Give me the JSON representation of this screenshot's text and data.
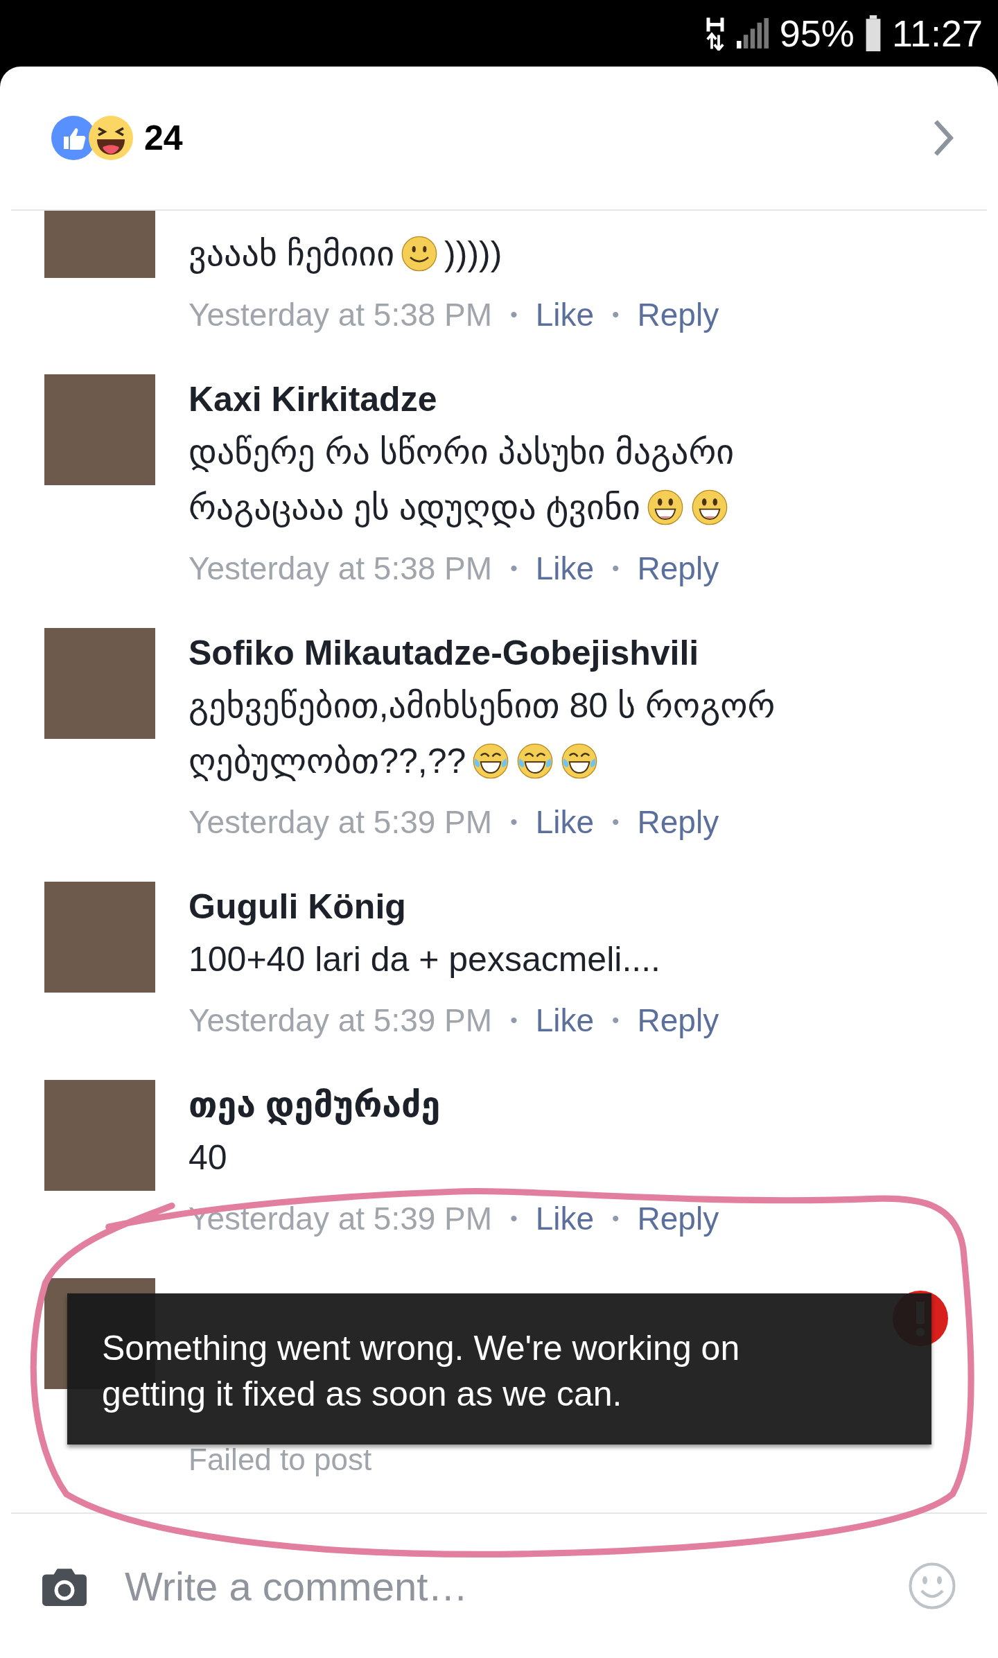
{
  "status_bar": {
    "battery": "95%",
    "time": "11:27"
  },
  "reactions": {
    "count": "24"
  },
  "comments": [
    {
      "kind": "posted",
      "body": [
        {
          "kind": "text",
          "text": "ვააახ ჩემიიი"
        },
        {
          "kind": "smile"
        },
        {
          "kind": "text",
          "text": ")))))"
        }
      ],
      "meta": [
        {
          "kind": "time",
          "text": "Yesterday at 5:38 PM"
        },
        {
          "kind": "dot",
          "text": "•"
        },
        {
          "kind": "like",
          "text": "Like"
        },
        {
          "kind": "dot",
          "text": "•"
        },
        {
          "kind": "reply",
          "text": "Reply"
        }
      ]
    },
    {
      "kind": "posted",
      "author": "Kaxi Kirkitadze",
      "body": [
        {
          "kind": "text",
          "text": "დაწერე რა სწორი პასუხი მაგარი"
        },
        {
          "kind": "text",
          "text": "რაგაცააა ეს ადუღდა ტვინი"
        },
        {
          "kind": "grin"
        },
        {
          "kind": "grin"
        }
      ],
      "meta": [
        {
          "kind": "time",
          "text": "Yesterday at 5:38 PM"
        },
        {
          "kind": "dot",
          "text": "•"
        },
        {
          "kind": "like",
          "text": "Like"
        },
        {
          "kind": "dot",
          "text": "•"
        },
        {
          "kind": "reply",
          "text": "Reply"
        }
      ]
    },
    {
      "kind": "posted",
      "author": "Sofiko Mikautadze-Gobejishvili",
      "body": [
        {
          "kind": "text",
          "text": "გეხვეწებით,ამიხსენით 80 ს როგორ"
        },
        {
          "kind": "text",
          "text": "ღებულობთ??,??"
        },
        {
          "kind": "joy"
        },
        {
          "kind": "joy"
        },
        {
          "kind": "joy"
        }
      ],
      "meta": [
        {
          "kind": "time",
          "text": "Yesterday at 5:39 PM"
        },
        {
          "kind": "dot",
          "text": "•"
        },
        {
          "kind": "like",
          "text": "Like"
        },
        {
          "kind": "dot",
          "text": "•"
        },
        {
          "kind": "reply",
          "text": "Reply"
        }
      ]
    },
    {
      "kind": "posted",
      "author": "Guguli König",
      "body": [
        {
          "kind": "text",
          "text": "100+40 lari da + pexsacmeli...."
        }
      ],
      "meta": [
        {
          "kind": "time",
          "text": "Yesterday at 5:39 PM"
        },
        {
          "kind": "dot",
          "text": "•"
        },
        {
          "kind": "like",
          "text": "Like"
        },
        {
          "kind": "dot",
          "text": "•"
        },
        {
          "kind": "reply",
          "text": "Reply"
        }
      ]
    },
    {
      "kind": "posted",
      "author": "თეა დემურაძე",
      "body": [
        {
          "kind": "text",
          "text": "40"
        }
      ],
      "meta": [
        {
          "kind": "time",
          "text": "Yesterday at 5:39 PM"
        },
        {
          "kind": "dot",
          "text": "•"
        },
        {
          "kind": "like",
          "text": "Like"
        },
        {
          "kind": "dot",
          "text": "•"
        },
        {
          "kind": "reply",
          "text": "Reply"
        }
      ]
    },
    {
      "kind": "failed",
      "status": "Failed to post"
    }
  ],
  "toast": {
    "message": "Something went wrong. We're working on getting it fixed as soon as we can."
  },
  "composer": {
    "placeholder": "Write a comment…"
  }
}
